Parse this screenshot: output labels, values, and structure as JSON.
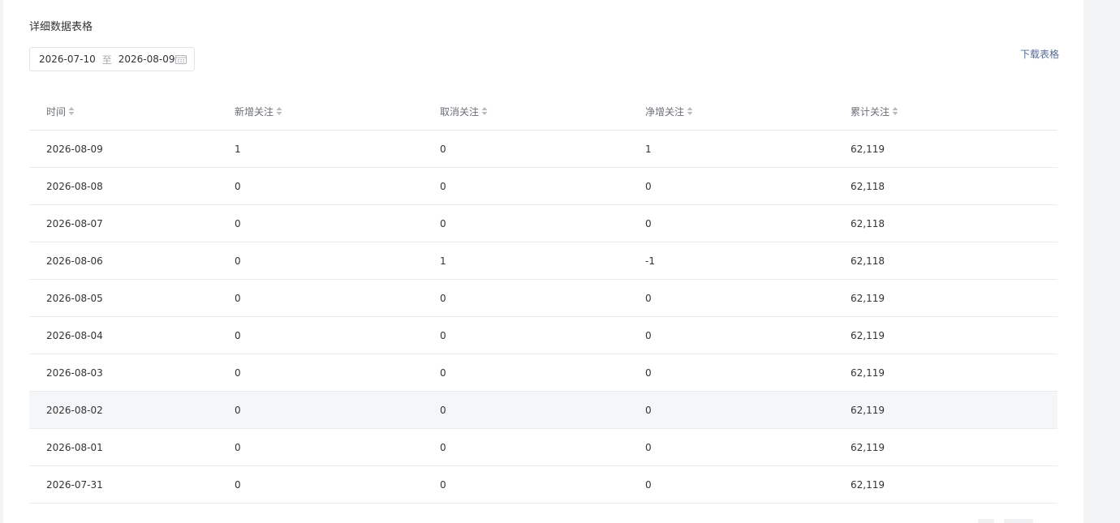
{
  "section": {
    "title": "详细数据表格"
  },
  "date_range": {
    "start": "2026-07-10",
    "separator": "至",
    "end": "2026-08-09",
    "icon": "calendar-icon"
  },
  "actions": {
    "download_label": "下载表格"
  },
  "table": {
    "headers": [
      "时间",
      "新增关注",
      "取消关注",
      "净增关注",
      "累计关注"
    ],
    "rows": [
      [
        "2026-08-09",
        "1",
        "0",
        "1",
        "62,119"
      ],
      [
        "2026-08-08",
        "0",
        "0",
        "0",
        "62,118"
      ],
      [
        "2026-08-07",
        "0",
        "0",
        "0",
        "62,118"
      ],
      [
        "2026-08-06",
        "0",
        "1",
        "-1",
        "62,118"
      ],
      [
        "2026-08-05",
        "0",
        "0",
        "0",
        "62,119"
      ],
      [
        "2026-08-04",
        "0",
        "0",
        "0",
        "62,119"
      ],
      [
        "2026-08-03",
        "0",
        "0",
        "0",
        "62,119"
      ],
      [
        "2026-08-02",
        "0",
        "0",
        "0",
        "62,119"
      ],
      [
        "2026-08-01",
        "0",
        "0",
        "0",
        "62,119"
      ],
      [
        "2026-07-31",
        "0",
        "0",
        "0",
        "62,119"
      ]
    ]
  },
  "colors": {
    "link": "#576b95",
    "hover_row": "#f5f6f8",
    "border": "#e9ebee",
    "page_background": "#f2f3f5"
  }
}
